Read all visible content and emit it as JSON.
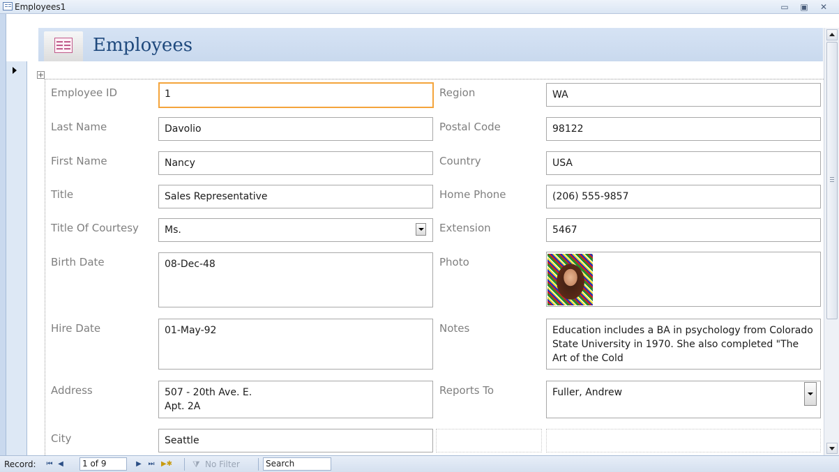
{
  "window": {
    "title": "Employees1",
    "minimize_icon": "minimize-icon",
    "restore_icon": "restore-icon",
    "close_icon": "close-icon",
    "minimize_glyph": "▭",
    "restore_glyph": "▣",
    "close_glyph": "✕"
  },
  "form": {
    "title": "Employees",
    "icon": "form-icon"
  },
  "fields": {
    "employee_id": {
      "label": "Employee ID",
      "value": "1"
    },
    "last_name": {
      "label": "Last Name",
      "value": "Davolio"
    },
    "first_name": {
      "label": "First Name",
      "value": "Nancy"
    },
    "title": {
      "label": "Title",
      "value": "Sales Representative"
    },
    "title_of_courtesy": {
      "label": "Title Of Courtesy",
      "value": "Ms."
    },
    "birth_date": {
      "label": "Birth Date",
      "value": "08-Dec-48"
    },
    "hire_date": {
      "label": "Hire Date",
      "value": "01-May-92"
    },
    "address": {
      "label": "Address",
      "value": "507 - 20th Ave. E.\nApt. 2A"
    },
    "city": {
      "label": "City",
      "value": "Seattle"
    },
    "region": {
      "label": "Region",
      "value": "WA"
    },
    "postal_code": {
      "label": "Postal Code",
      "value": "98122"
    },
    "country": {
      "label": "Country",
      "value": "USA"
    },
    "home_phone": {
      "label": "Home Phone",
      "value": "(206) 555-9857"
    },
    "extension": {
      "label": "Extension",
      "value": "5467"
    },
    "photo": {
      "label": "Photo"
    },
    "notes": {
      "label": "Notes",
      "value": "Education includes a BA in psychology from Colorado State University in 1970.  She also completed \"The Art of the Cold"
    },
    "reports_to": {
      "label": "Reports To",
      "value": "Fuller, Andrew"
    }
  },
  "navigation": {
    "record_label": "Record:",
    "first_glyph": "⏮",
    "prev_glyph": "◀",
    "position": "1 of 9",
    "next_glyph": "▶",
    "last_glyph": "⏭",
    "new_glyph": "▶✱",
    "filter_glyph": "⧩",
    "filter_label": "No Filter",
    "search_label": "Search"
  },
  "colors": {
    "header_bg": "#c9d9ee",
    "title_text": "#1f497d",
    "focus_border": "#f4a43b",
    "label_text": "#7f7f7f"
  }
}
